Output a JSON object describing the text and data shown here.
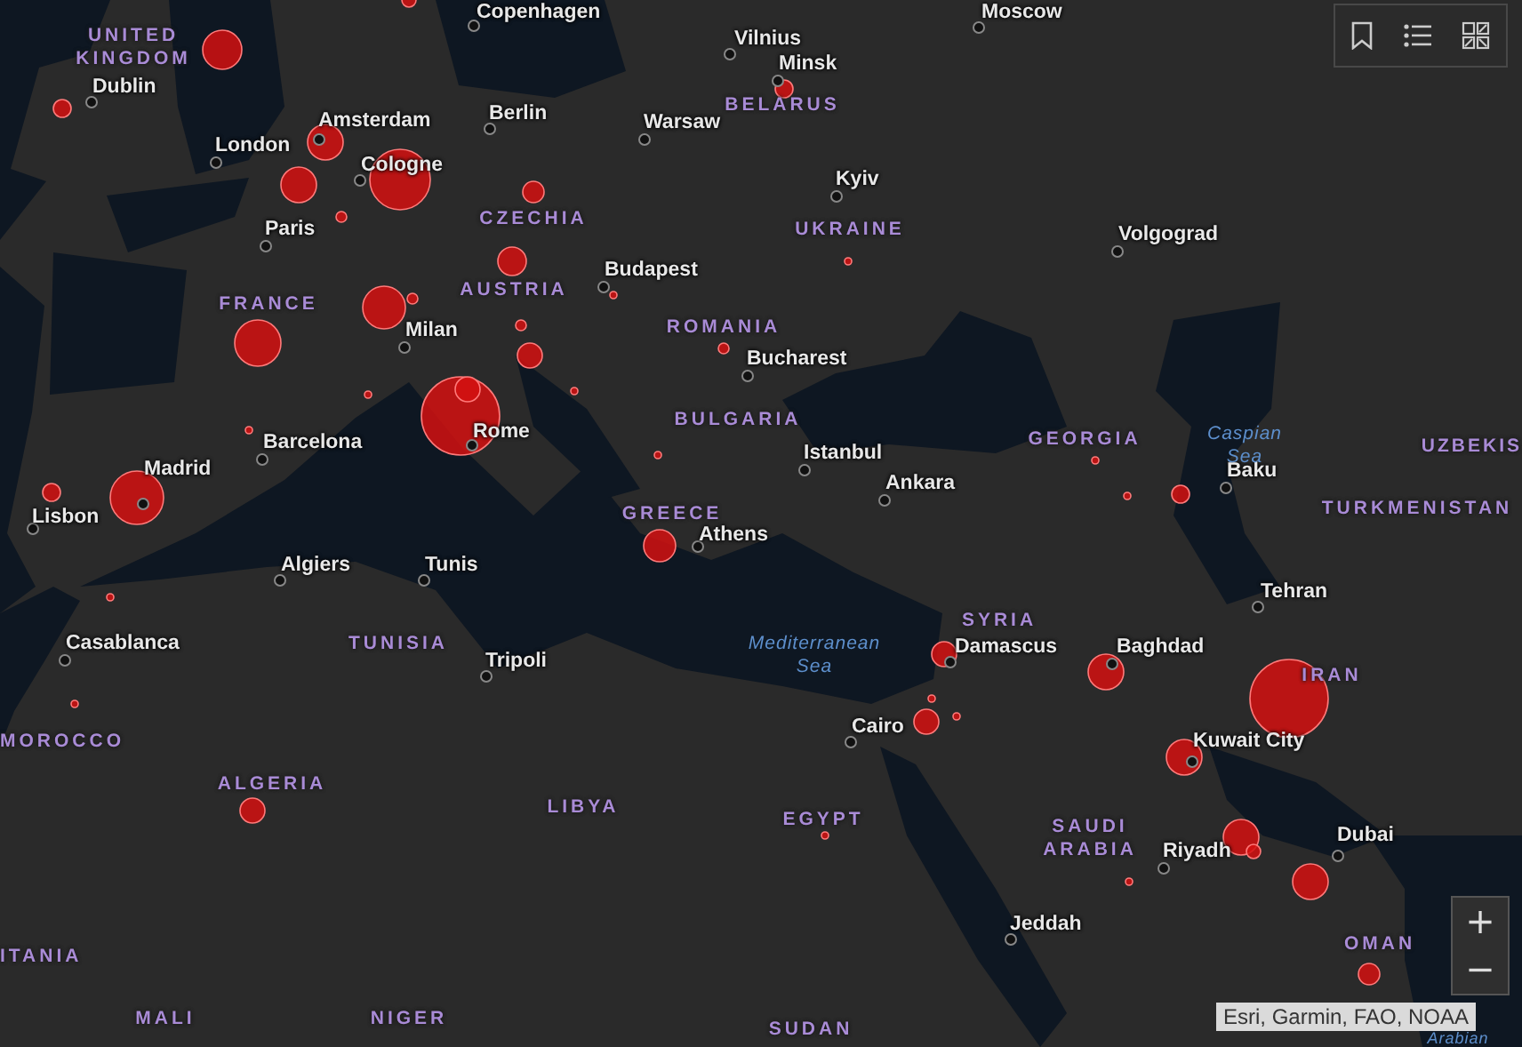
{
  "map": {
    "cities": [
      {
        "name": "Copenhagen"
      },
      {
        "name": "Moscow"
      },
      {
        "name": "Vilnius"
      },
      {
        "name": "Minsk"
      },
      {
        "name": "Dublin"
      },
      {
        "name": "Amsterdam"
      },
      {
        "name": "Berlin"
      },
      {
        "name": "Warsaw"
      },
      {
        "name": "London"
      },
      {
        "name": "Cologne"
      },
      {
        "name": "Kyiv"
      },
      {
        "name": "Paris"
      },
      {
        "name": "Volgograd"
      },
      {
        "name": "Budapest"
      },
      {
        "name": "Milan"
      },
      {
        "name": "Bucharest"
      },
      {
        "name": "Rome"
      },
      {
        "name": "Barcelona"
      },
      {
        "name": "Istanbul"
      },
      {
        "name": "Madrid"
      },
      {
        "name": "Baku"
      },
      {
        "name": "Ankara"
      },
      {
        "name": "Lisbon"
      },
      {
        "name": "Athens"
      },
      {
        "name": "Algiers"
      },
      {
        "name": "Tunis"
      },
      {
        "name": "Tehran"
      },
      {
        "name": "Casablanca"
      },
      {
        "name": "Damascus"
      },
      {
        "name": "Baghdad"
      },
      {
        "name": "Tripoli"
      },
      {
        "name": "Cairo"
      },
      {
        "name": "Kuwait City"
      },
      {
        "name": "Dubai"
      },
      {
        "name": "Riyadh"
      },
      {
        "name": "Jeddah"
      }
    ],
    "countries": [
      {
        "name": "UNITED KINGDOM"
      },
      {
        "name": "BELARUS"
      },
      {
        "name": "CZECHIA"
      },
      {
        "name": "UKRAINE"
      },
      {
        "name": "AUSTRIA"
      },
      {
        "name": "FRANCE"
      },
      {
        "name": "ROMANIA"
      },
      {
        "name": "BULGARIA"
      },
      {
        "name": "GEORGIA"
      },
      {
        "name": "UZBEKIS"
      },
      {
        "name": "GREECE"
      },
      {
        "name": "TURKMENISTAN"
      },
      {
        "name": "SYRIA"
      },
      {
        "name": "TUNISIA"
      },
      {
        "name": "IRAN"
      },
      {
        "name": "MOROCCO"
      },
      {
        "name": "ALGERIA"
      },
      {
        "name": "LIBYA"
      },
      {
        "name": "EGYPT"
      },
      {
        "name": "SAUDI ARABIA"
      },
      {
        "name": "OMAN"
      },
      {
        "name": "ITANIA"
      },
      {
        "name": "MALI"
      },
      {
        "name": "NIGER"
      },
      {
        "name": "SUDAN"
      }
    ],
    "seas": [
      {
        "name": "Caspian Sea"
      },
      {
        "name": "Mediterranean Sea"
      },
      {
        "name": "Arabian"
      }
    ]
  },
  "zoom_controls": {
    "zoom_in": "+",
    "zoom_out": "−"
  },
  "attribution": "Esri, Garmin, FAO, NOAA"
}
